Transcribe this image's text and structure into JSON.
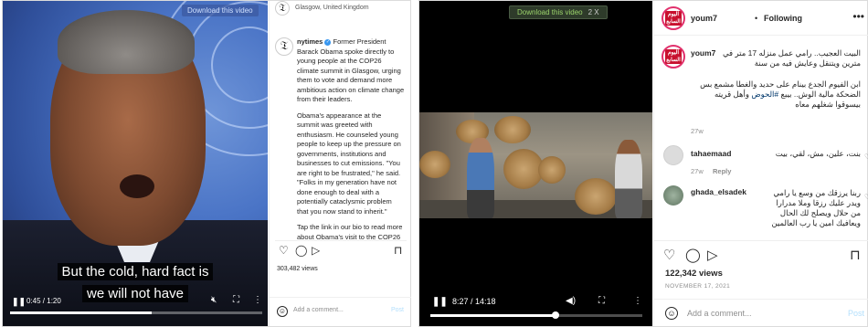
{
  "left_post": {
    "video": {
      "download_badge": "Download this video",
      "caption_line1": "But the cold, hard fact is",
      "caption_line2": "we will not have",
      "time": "0:45 / 1:20",
      "progress_fraction": 0.56
    },
    "location": "Glasgow, United Kingdom",
    "username": "nytimes",
    "caption_p1": "Former President Barack Obama spoke directly to young people at the COP26 climate summit in Glasgow, urging them to vote and demand more ambitious action on climate change from their leaders.",
    "caption_p2": "Obama's appearance at the summit was greeted with enthusiasm. He counseled young people to keep up the pressure on governments, institutions and businesses to cut emissions. \"You are right to be frustrated,\" he said. \"Folks in my generation have not done enough to deal with a potentially cataclysmic problem that you now stand to inherit.\"",
    "caption_p3": "Tap the link in our bio to read more about Obama's visit to the COP26",
    "views": "303,482 views",
    "comment_placeholder": "Add a comment...",
    "post_label": "Post"
  },
  "right_post": {
    "video": {
      "download_badge": "Download this video",
      "badge_extra": "2 X",
      "time": "8:27 / 14:18",
      "progress_fraction": 0.59
    },
    "header": {
      "username": "youm7",
      "separator": "•",
      "follow_label": "Following"
    },
    "caption": {
      "username": "youm7",
      "p1": "البيت العجيب.. رامي عمل منزله 17 متر في مترين ويتنقل وعايش فيه من سنة",
      "p2": "ابن الفيوم الجدع بينام على حديد والغطا مشمع بس الضحكة مالية الوش.. بيبع",
      "p3_tag": "#الحوض",
      "p3_rest": "وأهل قريته بيسوقوا شغلهم معاه",
      "time": "27w"
    },
    "comments": [
      {
        "username": "tahaemaad",
        "text": "بنت، علين، مش، لقي، بيت",
        "time": "27w",
        "reply": "Reply"
      },
      {
        "username": "ghada_elsadek",
        "text": "ربنا يرزقك من وسع يا رامي ويدر عليك رزقا وملا مدرارا من حلال ويصلح لك الحال ويعافيك امين يا رب العالمين"
      }
    ],
    "likes": "122,342 views",
    "date": "NOVEMBER 17, 2021",
    "comment_placeholder": "Add a comment...",
    "post_label": "Post"
  },
  "icons": {
    "heart": "♡",
    "comment": "◯",
    "share": "▷",
    "bookmark": "⊓"
  }
}
